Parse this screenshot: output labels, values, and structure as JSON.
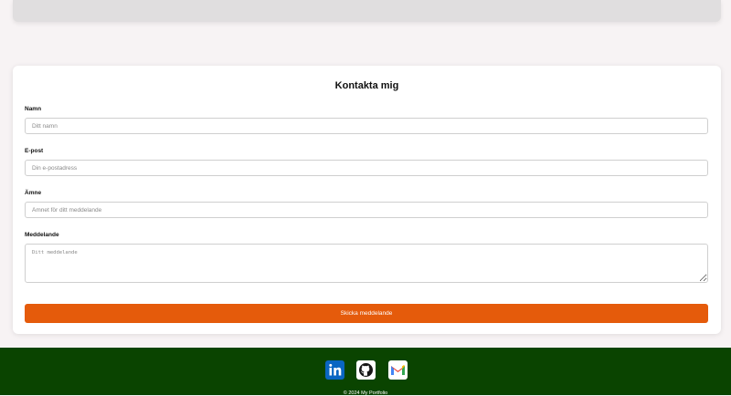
{
  "form": {
    "title": "Kontakta mig",
    "name_label": "Namn",
    "name_placeholder": "Ditt namn",
    "email_label": "E-post",
    "email_placeholder": "Din e-postadress",
    "subject_label": "Ämne",
    "subject_placeholder": "Ämnet för ditt meddelande",
    "message_label": "Meddelande",
    "message_placeholder": "Ditt meddelande",
    "submit_label": "Skicka meddelande"
  },
  "footer": {
    "social": [
      {
        "icon": "linkedin-icon",
        "color": "#0a66c2"
      },
      {
        "icon": "github-icon",
        "color": "#ffffff"
      },
      {
        "icon": "gmail-icon",
        "color": "#ffffff"
      }
    ],
    "copyright": "© 2024 My Portfolio"
  },
  "colors": {
    "accent": "#e55b0b",
    "footer_bg": "#0a4400",
    "page_bg": "#f7f3f4"
  }
}
